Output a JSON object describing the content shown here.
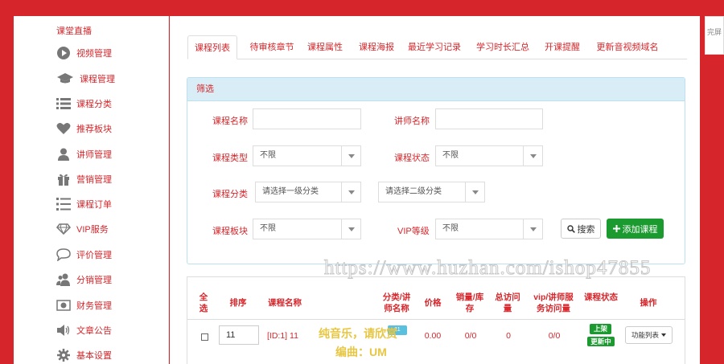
{
  "sidebar": {
    "header": "课堂直播",
    "items": [
      {
        "label": "视频管理",
        "icon": "play-circle-icon"
      },
      {
        "label": "课程管理",
        "icon": "graduation-cap-icon"
      },
      {
        "label": "课程分类",
        "icon": "list-icon"
      },
      {
        "label": "推荐板块",
        "icon": "heart-icon"
      },
      {
        "label": "讲师管理",
        "icon": "user-icon"
      },
      {
        "label": "营销管理",
        "icon": "gift-icon"
      },
      {
        "label": "课程订单",
        "icon": "list-ol-icon"
      },
      {
        "label": "VIP服务",
        "icon": "diamond-icon"
      },
      {
        "label": "评价管理",
        "icon": "comment-icon"
      },
      {
        "label": "分销管理",
        "icon": "users-icon"
      },
      {
        "label": "财务管理",
        "icon": "money-icon"
      },
      {
        "label": "文章公告",
        "icon": "volume-icon"
      },
      {
        "label": "基本设置",
        "icon": "gear-icon"
      }
    ]
  },
  "fullscreen_label": "完屏",
  "tabs": [
    "课程列表",
    "待审核章节",
    "课程属性",
    "课程海报",
    "最近学习记录",
    "学习时长汇总",
    "开课提醒",
    "更新音视频域名"
  ],
  "filter": {
    "title": "筛选",
    "course_name_label": "课程名称",
    "course_name_value": "",
    "teacher_name_label": "讲师名称",
    "teacher_name_value": "",
    "course_type_label": "课程类型",
    "course_type_value": "不限",
    "course_status_label": "课程状态",
    "course_status_value": "不限",
    "category_label": "课程分类",
    "category_level1": "请选择一级分类",
    "category_level2": "请选择二级分类",
    "block_label": "课程板块",
    "block_value": "不限",
    "vip_label": "VIP等级",
    "vip_value": "不限",
    "search_button": "搜索",
    "add_button": "添加课程"
  },
  "table": {
    "headers": [
      "全选",
      "排序",
      "课程名称",
      "分类/讲师名称",
      "价格",
      "销量/库存",
      "总访问量",
      "vip/讲师服务访问量",
      "课程状态",
      "操作"
    ],
    "rows": [
      {
        "sort": "11",
        "name": "[ID:1] 11",
        "category": "11",
        "price": "0.00",
        "sales_stock": "0/0",
        "visits": "0",
        "vip_visits": "0/0",
        "status_on": "上架",
        "status_update": "更新中",
        "ops": "功能列表"
      }
    ]
  },
  "watermark": {
    "url": "https://www.huzhan.com/ishop47855",
    "line1": "纯音乐，请欣赏",
    "line2": "编曲：UM"
  }
}
